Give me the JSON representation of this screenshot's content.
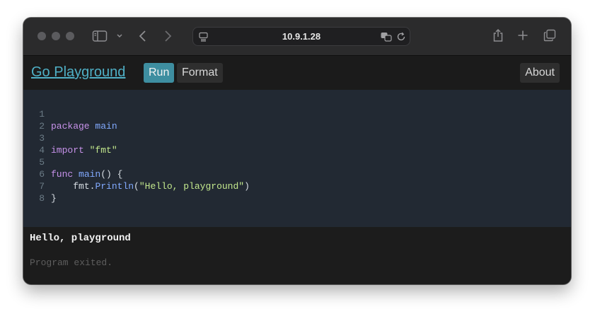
{
  "browser": {
    "url": "10.9.1.28"
  },
  "app": {
    "logo": "Go Playground",
    "run_label": "Run",
    "format_label": "Format",
    "about_label": "About"
  },
  "editor": {
    "line_numbers": [
      "1",
      "2",
      "3",
      "4",
      "5",
      "6",
      "7",
      "8"
    ],
    "line1": {
      "kw": "package",
      "name": "main"
    },
    "line3": {
      "kw": "import",
      "str": "\"fmt\""
    },
    "line5": {
      "kw": "func",
      "name": "main",
      "rest": "() {"
    },
    "line6": {
      "indent": "    ",
      "pkg": "fmt",
      "dot": ".",
      "fn": "Println",
      "open": "(",
      "str": "\"Hello, playground\"",
      "close": ")"
    },
    "line7": {
      "text": "}"
    }
  },
  "output": {
    "text": "Hello, playground",
    "status": "Program exited."
  },
  "colors": {
    "accent": "#3e8ea0",
    "link": "#4fb0c6",
    "editor_bg": "#222933",
    "keyword": "#c792ea",
    "function": "#82aaff",
    "string": "#c3e88d"
  }
}
